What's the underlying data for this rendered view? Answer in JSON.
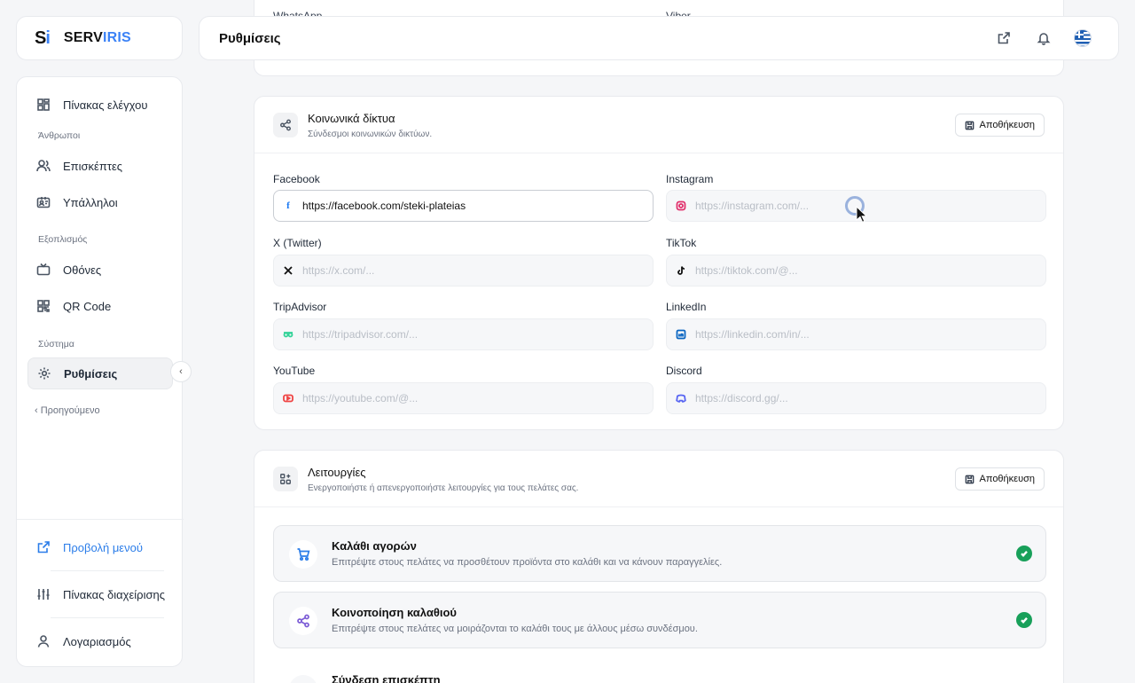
{
  "brand": {
    "mark_s": "S",
    "mark_i": "i",
    "name_a": "SERV",
    "name_b": "IRIS",
    "accent": "#3b82f6"
  },
  "header": {
    "title": "Ρυθμίσεις"
  },
  "sidebar": {
    "items": [
      {
        "label": "Πίνακας ελέγχου",
        "icon": "grid-icon"
      },
      {
        "label": "Επισκέπτες",
        "icon": "users-icon"
      },
      {
        "label": "Υπάλληλοι",
        "icon": "id-card-icon"
      },
      {
        "label": "Οθόνες",
        "icon": "tv-icon"
      },
      {
        "label": "QR Code",
        "icon": "qr-icon"
      },
      {
        "label": "Ρυθμίσεις",
        "icon": "gear-icon",
        "active": true
      }
    ],
    "sections": [
      "Άνθρωποι",
      "Εξοπλισμός",
      "Σύστημα"
    ],
    "prev": "‹ Προηγούμενο",
    "bottom": [
      {
        "label": "Προβολή μενού",
        "icon": "external-link-icon"
      },
      {
        "label": "Πίνακας διαχείρισης",
        "icon": "sliders-icon"
      },
      {
        "label": "Λογαριασμός",
        "icon": "user-icon"
      }
    ]
  },
  "top_card": {
    "left_label": "WhatsApp",
    "right_label": "Viber"
  },
  "social": {
    "title": "Κοινωνικά δίκτυα",
    "subtitle": "Σύνδεσμοι κοινωνικών δικτύων.",
    "save": "Αποθήκευση",
    "fields": [
      {
        "label": "Facebook",
        "value": "https://facebook.com/steki-plateias",
        "placeholder": ""
      },
      {
        "label": "Instagram",
        "value": "",
        "placeholder": "https://instagram.com/..."
      },
      {
        "label": "X (Twitter)",
        "value": "",
        "placeholder": "https://x.com/..."
      },
      {
        "label": "TikTok",
        "value": "",
        "placeholder": "https://tiktok.com/@..."
      },
      {
        "label": "TripAdvisor",
        "value": "",
        "placeholder": "https://tripadvisor.com/..."
      },
      {
        "label": "LinkedIn",
        "value": "",
        "placeholder": "https://linkedin.com/in/..."
      },
      {
        "label": "YouTube",
        "value": "",
        "placeholder": "https://youtube.com/@..."
      },
      {
        "label": "Discord",
        "value": "",
        "placeholder": "https://discord.gg/..."
      }
    ]
  },
  "features": {
    "title": "Λειτουργίες",
    "subtitle": "Ενεργοποιήστε ή απενεργοποιήστε λειτουργίες για τους πελάτες σας.",
    "save": "Αποθήκευση",
    "items": [
      {
        "title": "Καλάθι αγορών",
        "desc": "Επιτρέψτε στους πελάτες να προσθέτουν προϊόντα στο καλάθι και να κάνουν παραγγελίες.",
        "enabled": true
      },
      {
        "title": "Κοινοποίηση καλαθιού",
        "desc": "Επιτρέψτε στους πελάτες να μοιράζονται το καλάθι τους με άλλους μέσω συνδέσμου.",
        "enabled": true
      },
      {
        "title": "Σύνδεση επισκέπτη",
        "desc": "",
        "enabled": false
      }
    ]
  },
  "colors": {
    "success": "#18a05a",
    "link_blue": "#2b7de9"
  }
}
